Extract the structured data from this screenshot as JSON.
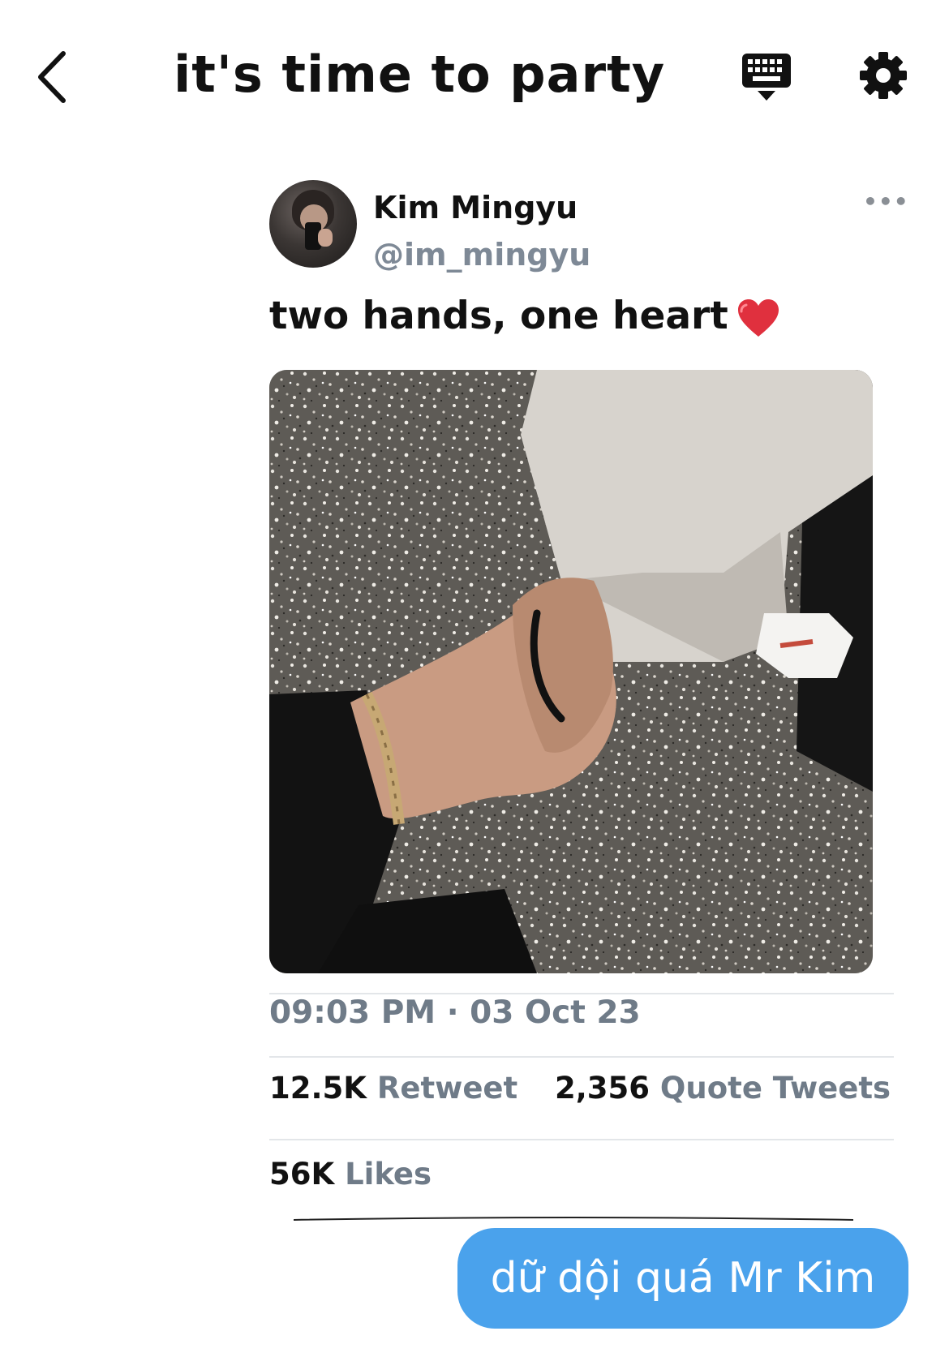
{
  "header": {
    "title": "it's time to party"
  },
  "tweet": {
    "author_name": "Kim Mingyu",
    "author_handle": "@im_mingyu",
    "more_label": "•••",
    "text": "two hands, one heart",
    "text_emoji": "red-heart-icon",
    "timestamp": "09:03 PM · 03 Oct 23",
    "retweets_count": "12.5K",
    "retweets_label": "Retweet",
    "quotes_count": "2,356",
    "quotes_label": "Quote Tweets",
    "likes_count": "56K",
    "likes_label": "Likes"
  },
  "message": {
    "text": "dữ dội quá Mr Kim"
  },
  "colors": {
    "bubble": "#4aa2ec",
    "muted_text": "#6f7b88",
    "heart": "#e0303e"
  },
  "icons": {
    "back": "chevron-left-icon",
    "keyboard": "keyboard-icon",
    "settings": "gear-icon"
  }
}
